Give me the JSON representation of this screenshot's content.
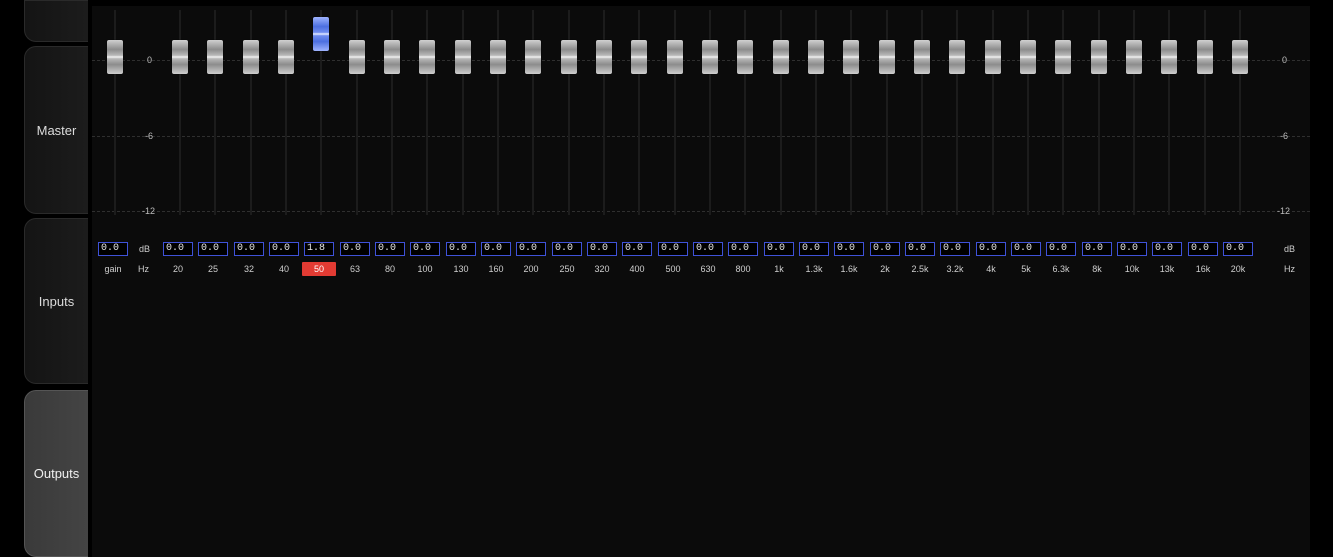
{
  "sidebar": {
    "tabs": [
      {
        "id": "master",
        "label": "Master",
        "active": false
      },
      {
        "id": "inputs",
        "label": "Inputs",
        "active": false
      },
      {
        "id": "outputs",
        "label": "Outputs",
        "active": true
      }
    ]
  },
  "eq": {
    "scale_labels": [
      "0",
      "-6",
      "-12"
    ],
    "units": {
      "db": "dB",
      "hz": "Hz"
    },
    "gain": {
      "value": "0.0",
      "label": "gain"
    },
    "selected_band_index": 4,
    "bands": [
      {
        "freq": "20",
        "gain": "0.0"
      },
      {
        "freq": "25",
        "gain": "0.0"
      },
      {
        "freq": "32",
        "gain": "0.0"
      },
      {
        "freq": "40",
        "gain": "0.0"
      },
      {
        "freq": "50",
        "gain": "1.8"
      },
      {
        "freq": "63",
        "gain": "0.0"
      },
      {
        "freq": "80",
        "gain": "0.0"
      },
      {
        "freq": "100",
        "gain": "0.0"
      },
      {
        "freq": "130",
        "gain": "0.0"
      },
      {
        "freq": "160",
        "gain": "0.0"
      },
      {
        "freq": "200",
        "gain": "0.0"
      },
      {
        "freq": "250",
        "gain": "0.0"
      },
      {
        "freq": "320",
        "gain": "0.0"
      },
      {
        "freq": "400",
        "gain": "0.0"
      },
      {
        "freq": "500",
        "gain": "0.0"
      },
      {
        "freq": "630",
        "gain": "0.0"
      },
      {
        "freq": "800",
        "gain": "0.0"
      },
      {
        "freq": "1k",
        "gain": "0.0"
      },
      {
        "freq": "1.3k",
        "gain": "0.0"
      },
      {
        "freq": "1.6k",
        "gain": "0.0"
      },
      {
        "freq": "2k",
        "gain": "0.0"
      },
      {
        "freq": "2.5k",
        "gain": "0.0"
      },
      {
        "freq": "3.2k",
        "gain": "0.0"
      },
      {
        "freq": "4k",
        "gain": "0.0"
      },
      {
        "freq": "5k",
        "gain": "0.0"
      },
      {
        "freq": "6.3k",
        "gain": "0.0"
      },
      {
        "freq": "8k",
        "gain": "0.0"
      },
      {
        "freq": "10k",
        "gain": "0.0"
      },
      {
        "freq": "13k",
        "gain": "0.0"
      },
      {
        "freq": "16k",
        "gain": "0.0"
      },
      {
        "freq": "20k",
        "gain": "0.0"
      }
    ],
    "colors": {
      "value_border": "#3f52d8",
      "selected_freq_bg": "#e23b33",
      "selected_knob": "#4c6fe0"
    }
  }
}
